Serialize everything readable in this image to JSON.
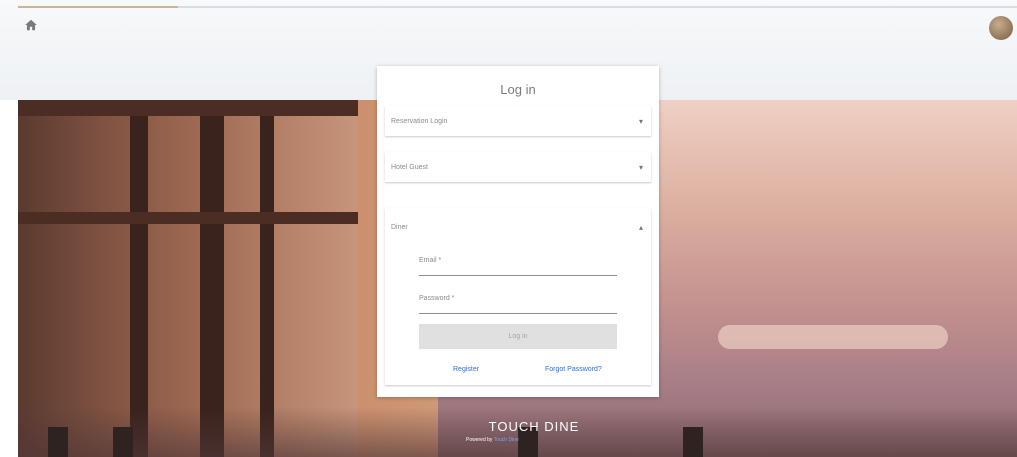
{
  "header": {
    "home_icon": "home-icon",
    "avatar": "avatar"
  },
  "login": {
    "title": "Log in",
    "panels": [
      {
        "label": "Reservation Login",
        "icon": "chevron-down-icon",
        "expanded": false
      },
      {
        "label": "Hotel Guest",
        "icon": "chevron-down-icon",
        "expanded": false
      },
      {
        "label": "Diner",
        "icon": "chevron-up-icon",
        "expanded": true
      }
    ],
    "email_label": "Email *",
    "password_label": "Password *",
    "login_button": "Log in",
    "register_link": "Register",
    "forgot_link": "Forgot Password?"
  },
  "branding": {
    "name": "TOUCH DINE",
    "powered_prefix": "Powered by",
    "powered_name": "Touch Dine"
  },
  "colors": {
    "link": "#2d6fd2",
    "button_disabled": "#e0e0e0"
  }
}
